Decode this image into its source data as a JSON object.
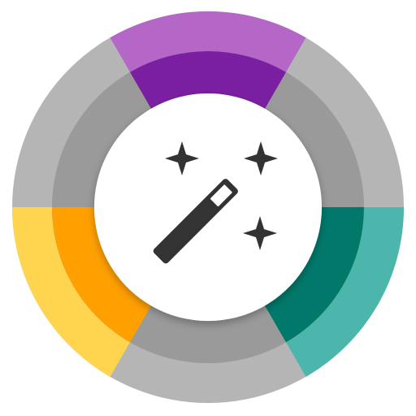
{
  "icon": {
    "name": "magic-wand-color-wheel-app-icon",
    "symbol": "magic-wand-with-sparkles",
    "colors": {
      "background": "#ffffff",
      "center_disc": "#ffffff",
      "outer_ring_gray": "#b5b5b5",
      "inner_ring_gray": "#9a9a9a",
      "wand_and_sparkles": "#333333",
      "wand_tip": "#ffffff"
    },
    "segments": [
      {
        "name": "purple",
        "outer": "#b467c7",
        "inner": "#7b1fa2"
      },
      {
        "name": "teal",
        "outer": "#4db6ac",
        "inner": "#00796b"
      },
      {
        "name": "yellow-orange",
        "outer": "#ffd54f",
        "inner": "#ffa000"
      }
    ]
  }
}
